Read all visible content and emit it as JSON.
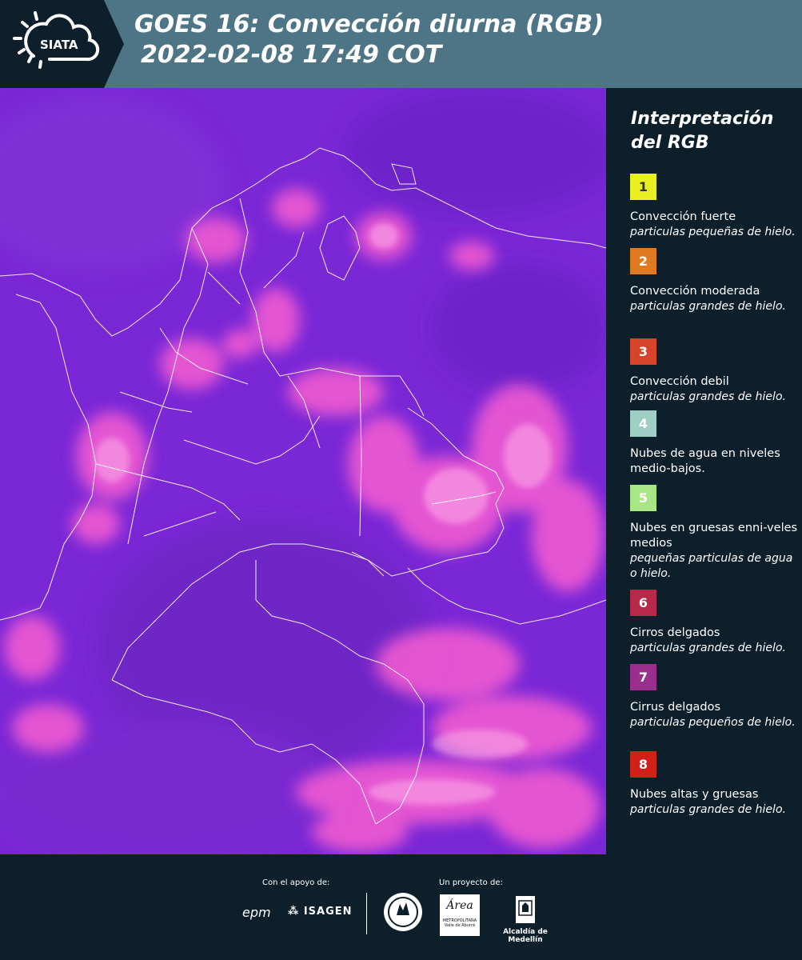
{
  "header": {
    "logo_text": "SIATA",
    "title_line1": "GOES 16: Convección diurna (RGB)",
    "title_line2": "2022-02-08 17:49 COT",
    "bg_color": "#4e7585"
  },
  "legend": {
    "title_line1": "Interpretación",
    "title_line2": "del RGB",
    "items": [
      {
        "num": "1",
        "color": "#e8f021",
        "label": "Convección fuerte",
        "sub": "particulas pequeñas de hielo."
      },
      {
        "num": "2",
        "color": "#e07a20",
        "label": "Convección moderada",
        "sub": "particulas grandes de hielo."
      },
      {
        "num": "3",
        "color": "#d6452a",
        "label": "Convección debil",
        "sub": "particulas grandes de hielo."
      },
      {
        "num": "4",
        "color": "#9fcfc4",
        "label": "Nubes de agua en niveles medio-bajos.",
        "sub": ""
      },
      {
        "num": "5",
        "color": "#a9e686",
        "label": "Nubes en gruesas enni-veles medios",
        "sub": "pequeñas particulas de agua o hielo."
      },
      {
        "num": "6",
        "color": "#b8284a",
        "label": "Cirros delgados",
        "sub": "particulas grandes de hielo."
      },
      {
        "num": "7",
        "color": "#9a2e8c",
        "label": "Cirrus delgados",
        "sub": "particulas pequeños de hielo."
      },
      {
        "num": "8",
        "color": "#d02018",
        "label": "Nubes altas y gruesas",
        "sub": "particulas grandes de hielo."
      }
    ]
  },
  "footer": {
    "support_label": "Con el apoyo de:",
    "project_label": "Un proyecto de:",
    "epm": "epm",
    "isagen": "ISAGEN",
    "area_text": "Área",
    "area_sub1": "METROPOLITANA",
    "area_sub2": "Valle de Aburrá",
    "alcaldia": "Alcaldía de Medellín"
  }
}
